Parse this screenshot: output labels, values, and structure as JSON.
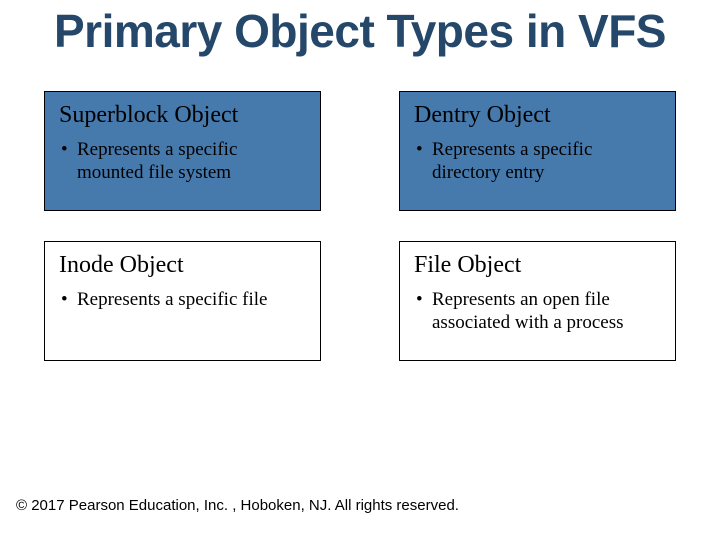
{
  "title": "Primary Object Types in VFS",
  "cards": [
    {
      "title": "Superblock Object",
      "bullet": "Represents a specific mounted file system",
      "bg": "blue"
    },
    {
      "title": "Dentry Object",
      "bullet": "Represents a specific directory entry",
      "bg": "blue"
    },
    {
      "title": "Inode Object",
      "bullet": "Represents a specific file",
      "bg": "white"
    },
    {
      "title": "File Object",
      "bullet": "Represents an open file associated with a process",
      "bg": "white"
    }
  ],
  "footer": "© 2017 Pearson Education, Inc. , Hoboken, NJ. All rights reserved."
}
